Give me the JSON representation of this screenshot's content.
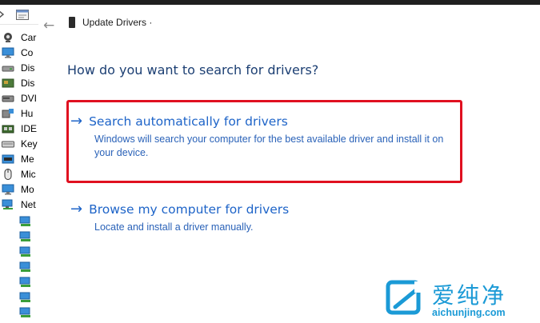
{
  "dialog": {
    "title": "Update Drivers ·",
    "back_icon": "back-arrow-icon",
    "question": "How do you want to search for drivers?",
    "options": [
      {
        "title": "Search automatically for drivers",
        "description_line1": "Windows will search your computer for the best available driver and install it on",
        "description_line2": "your device.",
        "highlighted": true
      },
      {
        "title": "Browse my computer for drivers",
        "description_line1": "Locate and install a driver manually.",
        "highlighted": false
      }
    ],
    "highlight_color": "#e01020",
    "link_color": "#1e64c8"
  },
  "device_list": {
    "items": [
      {
        "label": "Car",
        "icon": "camera-icon"
      },
      {
        "label": "Co",
        "icon": "monitor-icon"
      },
      {
        "label": "Dis",
        "icon": "disk-drive-icon"
      },
      {
        "label": "Dis",
        "icon": "display-adapter-icon"
      },
      {
        "label": "DVI",
        "icon": "dvd-drive-icon"
      },
      {
        "label": "Hu",
        "icon": "hid-icon"
      },
      {
        "label": "IDE",
        "icon": "ide-controller-icon"
      },
      {
        "label": "Key",
        "icon": "keyboard-icon"
      },
      {
        "label": "Me",
        "icon": "memory-icon"
      },
      {
        "label": "Mic",
        "icon": "mouse-icon"
      },
      {
        "label": "Mo",
        "icon": "monitor-icon"
      },
      {
        "label": "Net",
        "icon": "network-adapter-icon"
      }
    ]
  },
  "watermark": {
    "brand_cn": "爱纯净",
    "url": "aichunjing.com"
  }
}
